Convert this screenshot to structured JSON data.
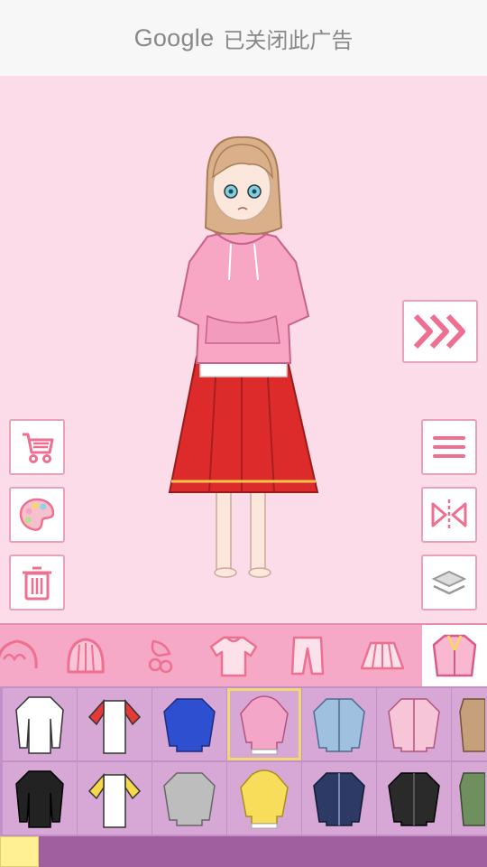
{
  "ad": {
    "brand": "Google",
    "message": "已关闭此广告"
  },
  "side_buttons_left": [
    {
      "name": "shop",
      "icon": "cart-icon"
    },
    {
      "name": "palette",
      "icon": "palette-icon"
    },
    {
      "name": "delete",
      "icon": "trash-icon"
    }
  ],
  "side_buttons_right": [
    {
      "name": "menu",
      "icon": "hamburger-icon"
    },
    {
      "name": "flip",
      "icon": "flip-icon"
    },
    {
      "name": "layers",
      "icon": "layers-icon"
    }
  ],
  "next_button": {
    "icon": "triple-chevron-right-icon"
  },
  "categories": [
    {
      "name": "hair-front",
      "icon": "hair-icon"
    },
    {
      "name": "hair-back",
      "icon": "hair-back-icon"
    },
    {
      "name": "accessory",
      "icon": "bow-icon"
    },
    {
      "name": "tshirt",
      "icon": "tshirt-icon"
    },
    {
      "name": "pants",
      "icon": "pants-icon"
    },
    {
      "name": "skirt",
      "icon": "skirt-icon"
    },
    {
      "name": "jacket",
      "icon": "jacket-icon",
      "selected": true
    }
  ],
  "items": [
    {
      "name": "white-longsleeve",
      "color": "#ffffff"
    },
    {
      "name": "raglan-red",
      "color": "#e53935"
    },
    {
      "name": "blue-sweatshirt",
      "color": "#2f4fd1"
    },
    {
      "name": "pink-hoodie",
      "color": "#f3a6c8",
      "selected": true
    },
    {
      "name": "light-denim-jacket",
      "color": "#9fc0df"
    },
    {
      "name": "pink-jacket",
      "color": "#f6c6d8"
    },
    {
      "name": "tan-coat",
      "color": "#c6a07a"
    },
    {
      "name": "black-longsleeve",
      "color": "#222222"
    },
    {
      "name": "raglan-yellow",
      "color": "#f7d84a"
    },
    {
      "name": "gray-sweatshirt",
      "color": "#bdbdbd"
    },
    {
      "name": "yellow-hoodie",
      "color": "#f7dd5a"
    },
    {
      "name": "dark-denim-jacket",
      "color": "#2e3a66"
    },
    {
      "name": "black-jacket",
      "color": "#2a2a2a"
    },
    {
      "name": "green-jacket",
      "color": "#6f8f5e"
    }
  ],
  "colors": {
    "stage_bg": "#fbdce8",
    "accent": "#e7a2b7",
    "category_bar": "#f6a9c6",
    "item_bg": "#d7a7d6",
    "selection": "#f2d872",
    "bottom_bar": "#a0609f"
  }
}
